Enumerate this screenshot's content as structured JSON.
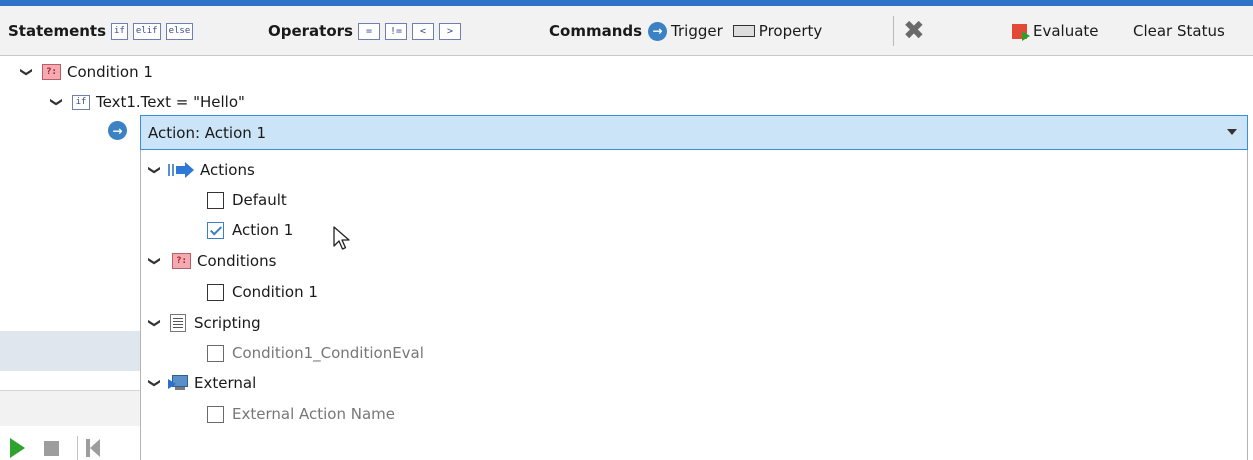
{
  "toolbar": {
    "statements": {
      "label": "Statements",
      "buttons": [
        "if",
        "elif",
        "else"
      ]
    },
    "operators": {
      "label": "Operators",
      "buttons": [
        "=",
        "!=",
        "<",
        ">"
      ]
    },
    "commands": {
      "label": "Commands",
      "trigger_label": "Trigger",
      "property_label": "Property"
    },
    "evaluate_label": "Evaluate",
    "clear_status_label": "Clear Status"
  },
  "tree": {
    "condition_label": "Condition 1",
    "condition_icon_text": "?:",
    "if_icon_text": "if",
    "if_expression": "Text1.Text = \"Hello\""
  },
  "action_combo": {
    "selected_label": "Action: Action 1"
  },
  "dropdown": {
    "groups": [
      {
        "label": "Actions",
        "icon": "actions-arrow-icon",
        "items": [
          {
            "label": "Default",
            "checked": false,
            "enabled": true
          },
          {
            "label": "Action 1",
            "checked": true,
            "enabled": true
          }
        ]
      },
      {
        "label": "Conditions",
        "icon": "condition-icon",
        "icon_text": "?:",
        "items": [
          {
            "label": "Condition 1",
            "checked": false,
            "enabled": true
          }
        ]
      },
      {
        "label": "Scripting",
        "icon": "script-icon",
        "items": [
          {
            "label": "Condition1_ConditionEval",
            "checked": false,
            "enabled": false
          }
        ]
      },
      {
        "label": "External",
        "icon": "external-icon",
        "items": [
          {
            "label": "External Action Name",
            "checked": false,
            "enabled": false
          }
        ]
      }
    ]
  },
  "colors": {
    "accent": "#3b8ddd",
    "combo_selected_bg": "#cce4f7",
    "play_green": "#2fa12f",
    "condition_pink": "#f3aab0"
  }
}
